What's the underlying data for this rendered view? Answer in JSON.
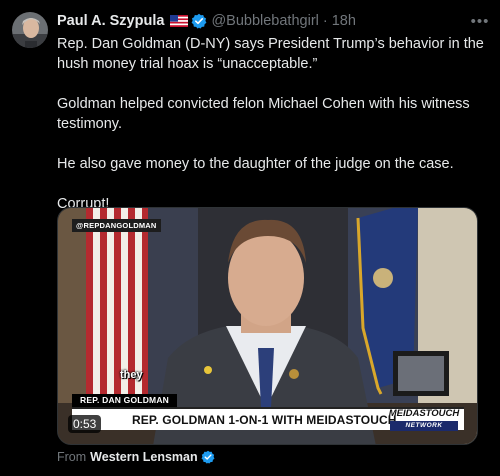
{
  "author": {
    "name": "Paul A. Szypula",
    "flag_icon": "us-flag-icon",
    "verified_icon": "verified-badge-icon",
    "handle": "@Bubblebathgirl",
    "separator": "·",
    "time": "18h",
    "more_icon": "more-options-icon",
    "more_label": "•••"
  },
  "tweet": {
    "paragraphs": [
      "Rep. Dan Goldman (D-NY) says President Trump’s behavior in the hush money trial hoax is “unacceptable.”",
      "Goldman helped convicted felon Michael Cohen with his witness testimony.",
      "He also gave money to the daughter of the judge on the case.",
      "Corrupt!"
    ]
  },
  "video": {
    "overlay_handle": "@REPDANGOLDMAN",
    "caption": "they",
    "name_tag": "REP. DAN GOLDMAN",
    "lower_third": "REP. GOLDMAN 1-ON-1 WITH MEIDASTOUCH",
    "logo_main": "MEIDASTOUCH",
    "logo_sub": "NETWORK",
    "duration": "0:53"
  },
  "source": {
    "prefix": "From",
    "name": "Western Lensman"
  },
  "colors": {
    "background": "#000000",
    "text": "#e7e9ea",
    "muted": "#71767b",
    "verified": "#1d9bf0"
  }
}
